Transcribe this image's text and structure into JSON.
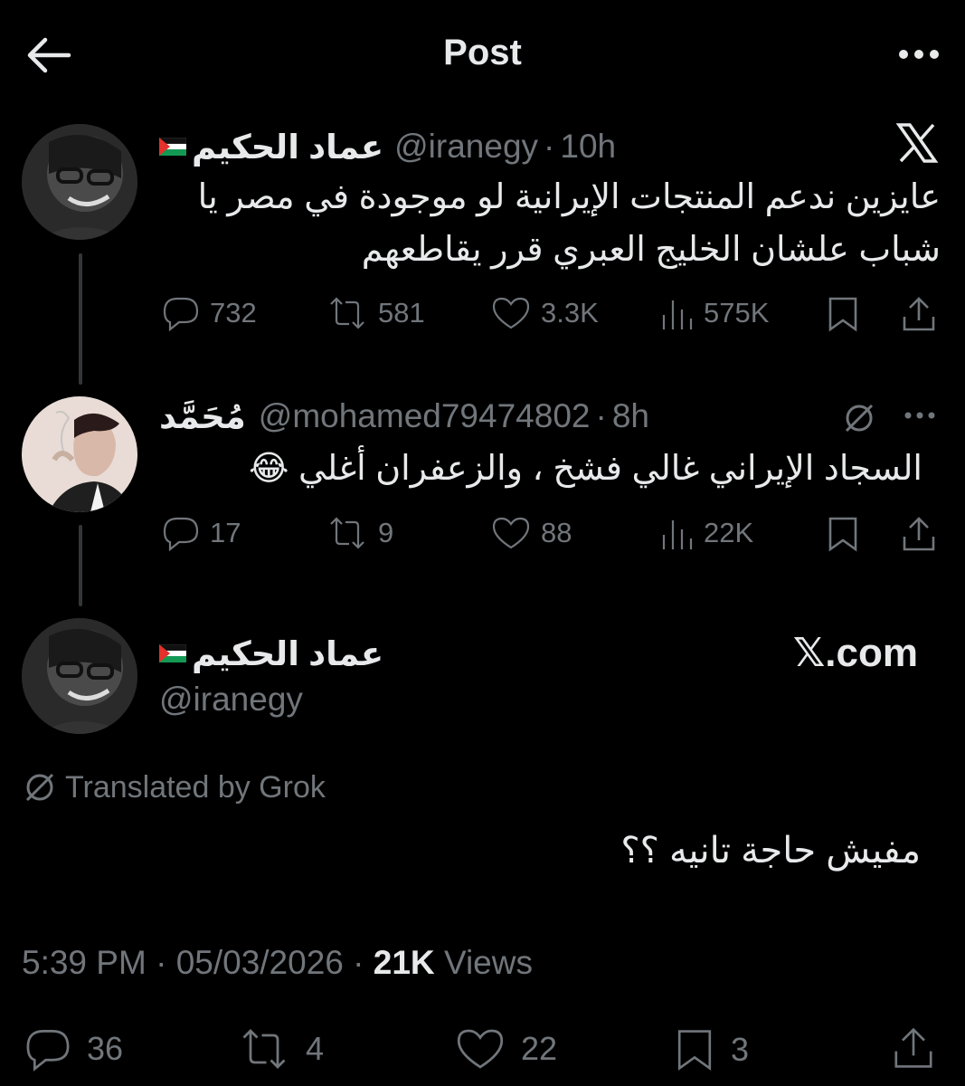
{
  "header": {
    "title": "Post",
    "back_icon": "arrow-left-icon",
    "more_icon": "more-horizontal-icon"
  },
  "tweet1": {
    "name": "عماد الحكيم",
    "handle": "@iranegy",
    "sep": "·",
    "time": "10h",
    "text_line1": "عايزين ندعم المنتجات الإيرانية لو موجودة في مصر يا",
    "text_line2": "شباب علشان الخليج العبري قرر يقاطعهم",
    "replies": "732",
    "reposts": "581",
    "likes": "3.3K",
    "views": "575K"
  },
  "tweet2": {
    "name": "مُحَمَّد",
    "handle": "@mohamed79474802",
    "sep": "·",
    "time": "8h",
    "text": "السجاد الإيراني غالي فشخ ، والزعفران أغلي 😂",
    "replies": "17",
    "reposts": "9",
    "likes": "88",
    "views": "22K"
  },
  "main_post": {
    "name": "عماد الحكيم",
    "handle": "@iranegy",
    "source": "𝕏.com",
    "translated_label": "Translated by Grok",
    "text": "مفيش حاجة تانيه ؟؟",
    "time": "5:39 PM",
    "date": "05/03/2026",
    "sep": "·",
    "views_count": "21K",
    "views_label": "Views",
    "replies": "36",
    "reposts": "4",
    "likes": "22",
    "bookmarks": "3"
  },
  "colors": {
    "background": "#000000",
    "text": "#e7e9ea",
    "muted": "#71767b",
    "thread_line": "#333639"
  }
}
